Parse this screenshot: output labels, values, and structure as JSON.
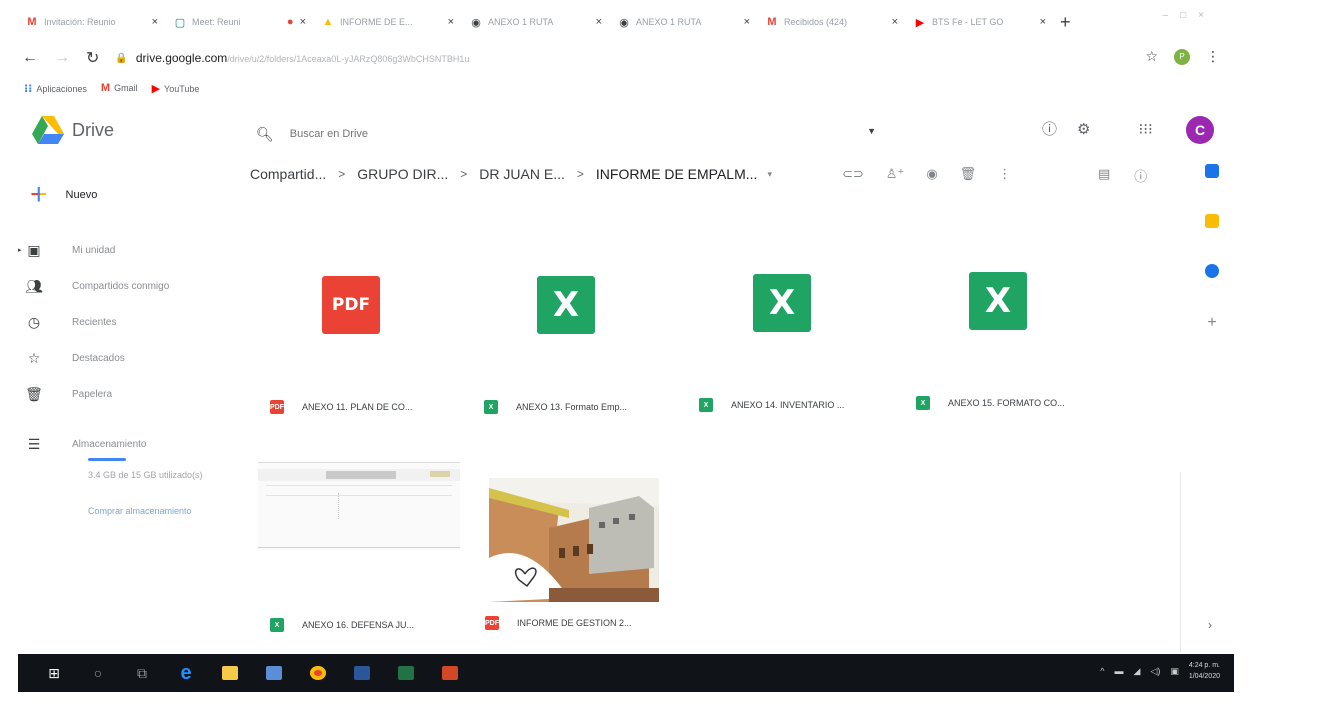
{
  "browser": {
    "tabs": [
      {
        "icon": "gmail-icon",
        "label": "Invitación: Reunio"
      },
      {
        "icon": "meet-icon",
        "label": "Meet: Reuni"
      },
      {
        "icon": "drive-icon",
        "label": "INFORME DE E..."
      },
      {
        "icon": "globe-icon",
        "label": "ANEXO 1 RUTA"
      },
      {
        "icon": "globe-icon",
        "label": "ANEXO 1 RUTA"
      },
      {
        "icon": "gmail-icon",
        "label": "Recibidos (424)"
      },
      {
        "icon": "youtube-icon",
        "label": "BTS Fe - LET GO"
      }
    ],
    "address": {
      "host": "drive.google.com",
      "path": "/drive/u/2/folders/1Aceaxa0L-yJARzQ806g3WbCHSNTBH1u"
    },
    "bookmarks": [
      {
        "icon": "apps-grid-icon",
        "label": "Aplicaciones"
      },
      {
        "icon": "gmail-icon",
        "label": "Gmail"
      },
      {
        "icon": "youtube-icon",
        "label": "YouTube"
      }
    ]
  },
  "drive": {
    "app_name": "Drive",
    "search_placeholder": "Buscar en Drive",
    "avatar_letter": "C",
    "new_label": "Nuevo",
    "nav": [
      {
        "icon": "my-drive-icon",
        "label": "Mi unidad"
      },
      {
        "icon": "shared-icon",
        "label": "Compartidos conmigo"
      },
      {
        "icon": "clock-icon",
        "label": "Recientes"
      },
      {
        "icon": "star-icon",
        "label": "Destacados"
      },
      {
        "icon": "trash-icon",
        "label": "Papelera"
      },
      {
        "icon": "storage-icon",
        "label": "Almacenamiento"
      }
    ],
    "storage_text": "3.4 GB de 15 GB utilizado(s)",
    "buy_storage": "Comprar almacenamiento",
    "breadcrumb": {
      "items": [
        "Compartid...",
        "GRUPO DIR...",
        "DR JUAN E..."
      ],
      "current": "INFORME DE EMPALM..."
    },
    "files": [
      {
        "type": "pdf",
        "name": "ANEXO 11. PLAN DE CO..."
      },
      {
        "type": "xls",
        "name": "ANEXO 13. Formato Emp..."
      },
      {
        "type": "xls",
        "name": "ANEXO 14. INVENTARIO ..."
      },
      {
        "type": "xls",
        "name": "ANEXO 15. FORMATO CO..."
      },
      {
        "type": "xls",
        "name": "ANEXO 16. DEFENSA JU..."
      },
      {
        "type": "pdf",
        "name": "INFORME DE GESTION 2..."
      }
    ],
    "icon_texts": {
      "pdf": "PDF",
      "xls": "X"
    }
  },
  "taskbar": {
    "time": "4:24 p. m.",
    "date": "1/04/2020"
  },
  "colors": {
    "pdf": "#ea4335",
    "xls": "#1fa463",
    "avatar": "#9c27b0",
    "taskbar": "#101418"
  }
}
